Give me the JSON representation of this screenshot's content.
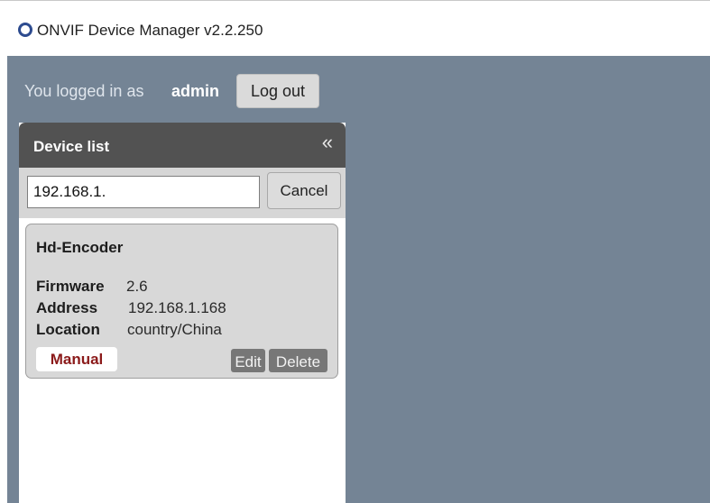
{
  "window": {
    "title": "ONVIF Device Manager v2.2.250",
    "icon": "onvif-ring-icon",
    "accent": "#2d4b8f"
  },
  "login": {
    "prefix": "You logged in as",
    "user": "admin",
    "logout_label": "Log out"
  },
  "device_list": {
    "title": "Device list",
    "collapse_glyph": "«",
    "collapse_icon": "double-chevron-left-icon",
    "search_value": "192.168.1.",
    "cancel_label": "Cancel",
    "devices": [
      {
        "name": "Hd-Encoder",
        "firmware_label": "Firmware",
        "firmware": "2.6",
        "address_label": "Address",
        "address": "192.168.1.168",
        "location_label": "Location",
        "location": "country/China",
        "badge": "Manual",
        "edit_label": "Edit",
        "delete_label": "Delete"
      }
    ]
  },
  "colors": {
    "workspace": "#748495",
    "panel_header": "#525252",
    "manual_badge_text": "#8b1a1a"
  }
}
